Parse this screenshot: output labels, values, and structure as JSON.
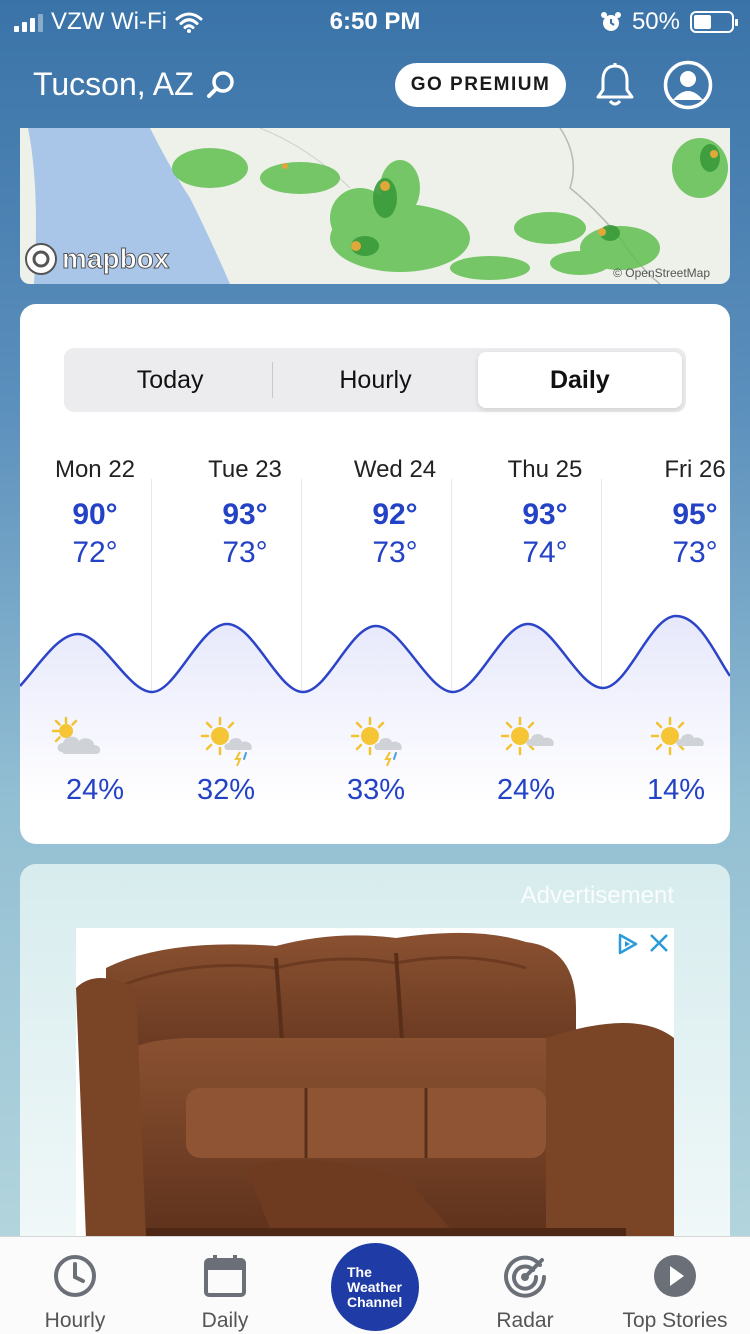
{
  "status_bar": {
    "carrier": "VZW Wi-Fi",
    "time": "6:50 PM",
    "battery_percent": "50%",
    "battery_level": 0.5
  },
  "header": {
    "location": "Tucson, AZ",
    "premium_label": "GO PREMIUM"
  },
  "map": {
    "brand": "mapbox",
    "attribution": "© OpenStreetMap"
  },
  "forecast": {
    "tabs": [
      {
        "label": "Today",
        "active": false
      },
      {
        "label": "Hourly",
        "active": false
      },
      {
        "label": "Daily",
        "active": true
      }
    ],
    "days": [
      {
        "name": "Mon 22",
        "high": "90°",
        "low": "72°",
        "precip": "24%",
        "icon": "partly-cloudy-icon"
      },
      {
        "name": "Tue 23",
        "high": "93°",
        "low": "73°",
        "precip": "32%",
        "icon": "sun-thunderstorm-icon"
      },
      {
        "name": "Wed 24",
        "high": "92°",
        "low": "73°",
        "precip": "33%",
        "icon": "sun-thunderstorm-icon"
      },
      {
        "name": "Thu 25",
        "high": "93°",
        "low": "74°",
        "precip": "24%",
        "icon": "mostly-sunny-icon"
      },
      {
        "name": "Fri 26",
        "high": "95°",
        "low": "73°",
        "precip": "14%",
        "icon": "mostly-sunny-icon"
      }
    ],
    "colors": {
      "accent": "#2342c6",
      "wave": "#2b44c8"
    }
  },
  "ad": {
    "label": "Advertisement"
  },
  "bottom_nav": {
    "items": [
      {
        "label": "Hourly",
        "icon": "clock-icon"
      },
      {
        "label": "Daily",
        "icon": "calendar-icon"
      },
      {
        "label": "",
        "icon": "weather-channel-logo"
      },
      {
        "label": "Radar",
        "icon": "radar-icon"
      },
      {
        "label": "Top Stories",
        "icon": "play-icon"
      }
    ],
    "logo_lines": [
      "The",
      "Weather",
      "Channel"
    ]
  }
}
